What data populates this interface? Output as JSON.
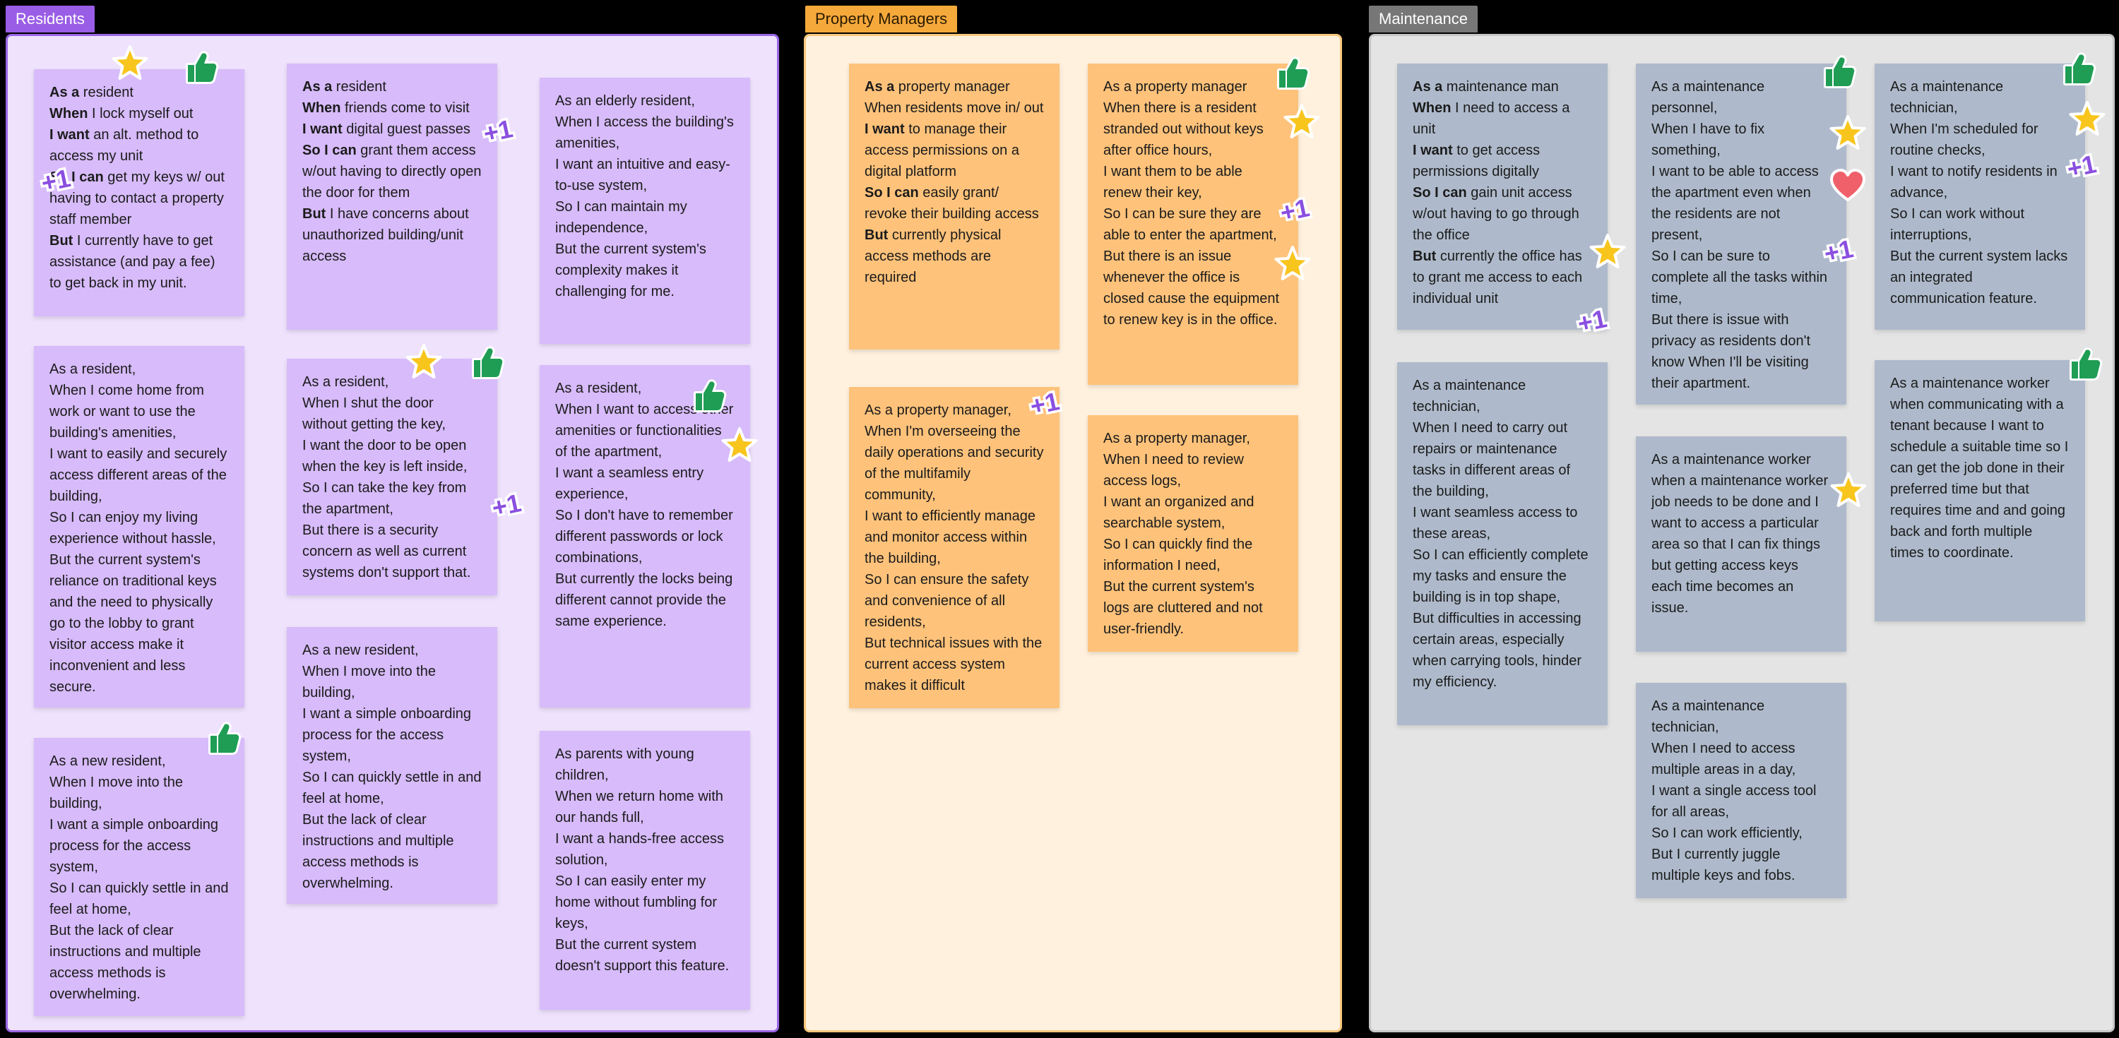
{
  "sections": {
    "residents": "Residents",
    "property_managers": "Property Managers",
    "maintenance": "Maintenance"
  },
  "colors": {
    "residents_note": "#d7bbfa",
    "pm_note": "#fec27a",
    "maintenance_note": "#aebacb",
    "thumb": "#1f9d55",
    "star": "#f8c51c",
    "plus_one": "#8a4fe0",
    "heart": "#f0606a"
  },
  "stickers": {
    "thumb": "thumbs-up",
    "star": "star",
    "plus_one": "+1",
    "heart": "heart"
  },
  "notes": {
    "r1": [
      {
        "k": "As a",
        "t": " resident"
      },
      {
        "k": "When",
        "t": " I lock myself out"
      },
      {
        "k": "I want",
        "t": " an alt. method to access my unit"
      },
      {
        "k": "So I can",
        "t": " get my keys w/ out having to contact a property staff member"
      },
      {
        "k": "But",
        "t": " I currently have to get assistance (and pay a fee) to get back in my unit."
      }
    ],
    "r2": [
      {
        "k": "As a",
        "t": " resident"
      },
      {
        "k": "When",
        "t": " friends come to visit"
      },
      {
        "k": "I want",
        "t": " digital guest passes"
      },
      {
        "k": "So I can",
        "t": " grant them access w/out having to directly open the door for them"
      },
      {
        "k": "But",
        "t": " I have concerns about unauthorized building/unit access"
      }
    ],
    "r3": [
      {
        "k": "",
        "t": "As an elderly resident,"
      },
      {
        "k": "",
        "t": "When I access the building's amenities,"
      },
      {
        "k": "",
        "t": "I want an intuitive and easy-to-use system,"
      },
      {
        "k": "",
        "t": "So I can maintain my independence,"
      },
      {
        "k": "",
        "t": "But the current system's complexity makes it challenging for me."
      }
    ],
    "r4": [
      {
        "k": "",
        "t": "As a resident,"
      },
      {
        "k": "",
        "t": "When I come home from work or want to use the building's amenities,"
      },
      {
        "k": "",
        "t": "I want to easily and securely access different areas of the building,"
      },
      {
        "k": "",
        "t": "So I can enjoy my living experience without hassle,"
      },
      {
        "k": "",
        "t": "But the current system's reliance on traditional keys and the need to physically go to the lobby to grant visitor access make it inconvenient and less secure."
      }
    ],
    "r5": [
      {
        "k": "",
        "t": "As a resident,"
      },
      {
        "k": "",
        "t": "When I shut the door without getting the key,"
      },
      {
        "k": "",
        "t": "I want the door to be open when the key is left inside,"
      },
      {
        "k": "",
        "t": "So I can take the key from the apartment,"
      },
      {
        "k": "",
        "t": "But there is a security concern as well as current systems don't support that."
      }
    ],
    "r6": [
      {
        "k": "",
        "t": "As a resident,"
      },
      {
        "k": "",
        "t": "When I want to access other amenities or functionalities of the apartment,"
      },
      {
        "k": "",
        "t": "I want a seamless entry experience,"
      },
      {
        "k": "",
        "t": "So I don't have to remember different passwords or lock combinations,"
      },
      {
        "k": "",
        "t": "But currently the locks being different cannot provide the same experience."
      }
    ],
    "r7": [
      {
        "k": "",
        "t": "As a new resident,"
      },
      {
        "k": "",
        "t": "When I move into the building,"
      },
      {
        "k": "",
        "t": "I want a simple onboarding process for the access system,"
      },
      {
        "k": "",
        "t": "So I can quickly settle in and feel at home,"
      },
      {
        "k": "",
        "t": "But the lack of clear instructions and multiple access methods is overwhelming."
      }
    ],
    "r8": [
      {
        "k": "",
        "t": "As a new resident,"
      },
      {
        "k": "",
        "t": "When I move into the building,"
      },
      {
        "k": "",
        "t": "I want a simple onboarding process for the access system,"
      },
      {
        "k": "",
        "t": "So I can quickly settle in and feel at home,"
      },
      {
        "k": "",
        "t": "But the lack of clear instructions and multiple access methods is overwhelming."
      }
    ],
    "r9": [
      {
        "k": "",
        "t": "As parents with young children,"
      },
      {
        "k": "",
        "t": "When we return home with our hands full,"
      },
      {
        "k": "",
        "t": "I want a hands-free access solution,"
      },
      {
        "k": "",
        "t": "So I can easily enter my home without fumbling for keys,"
      },
      {
        "k": "",
        "t": "But the current system doesn't support this feature."
      }
    ],
    "p1": [
      {
        "k": "As a",
        "t": " property manager"
      },
      {
        "k": "",
        "t": "When residents move in/ out"
      },
      {
        "k": "I want",
        "t": " to manage their access permissions on a digital platform"
      },
      {
        "k": "So I can",
        "t": " easily grant/ revoke their building access"
      },
      {
        "k": "But",
        "t": " currently physical access methods are required"
      }
    ],
    "p2": [
      {
        "k": "",
        "t": "As a property manager"
      },
      {
        "k": "",
        "t": "When there is a resident stranded out without keys after office hours,"
      },
      {
        "k": "",
        "t": "I want them to be able renew their key,"
      },
      {
        "k": "",
        "t": "So I can be sure they are able to enter the apartment,"
      },
      {
        "k": "",
        "t": "But there is an issue whenever the office is closed cause the equipment to renew key is in the office."
      }
    ],
    "p3": [
      {
        "k": "",
        "t": "As a property manager,"
      },
      {
        "k": "",
        "t": "When I'm overseeing the daily operations and security of the multifamily community,"
      },
      {
        "k": "",
        "t": "I want to efficiently manage and monitor access within the building,"
      },
      {
        "k": "",
        "t": "So I can ensure the safety and convenience of all residents,"
      },
      {
        "k": "",
        "t": "But technical issues with the current access system makes it difficult"
      }
    ],
    "p4": [
      {
        "k": "",
        "t": "As a property manager,"
      },
      {
        "k": "",
        "t": "When I need to review access logs,"
      },
      {
        "k": "",
        "t": "I want an organized and searchable system,"
      },
      {
        "k": "",
        "t": "So I can quickly find the information I need,"
      },
      {
        "k": "",
        "t": "But the current system's logs are cluttered and not user-friendly."
      }
    ],
    "m1": [
      {
        "k": "As a",
        "t": " maintenance man"
      },
      {
        "k": "When",
        "t": " I need to access a unit"
      },
      {
        "k": "I want",
        "t": " to get access permissions digitally"
      },
      {
        "k": "So I can",
        "t": " gain unit access w/out having to go through the office"
      },
      {
        "k": "But",
        "t": " currently the office has to grant me access to each individual unit"
      }
    ],
    "m2": [
      {
        "k": "",
        "t": "As a maintenance personnel,"
      },
      {
        "k": "",
        "t": "When I have to fix something,"
      },
      {
        "k": "",
        "t": "I want to be able to access the apartment even when the residents are not present,"
      },
      {
        "k": "",
        "t": "So I can be sure to complete all the tasks within time,"
      },
      {
        "k": "",
        "t": "But there is issue with privacy as residents don't know When I'll be visiting their apartment."
      }
    ],
    "m3": [
      {
        "k": "",
        "t": "As a maintenance technician,"
      },
      {
        "k": "",
        "t": "When I'm scheduled for routine checks,"
      },
      {
        "k": "",
        "t": "I want to notify residents in advance,"
      },
      {
        "k": "",
        "t": "So I can work without interruptions,"
      },
      {
        "k": "",
        "t": "But the current system lacks an integrated communication feature."
      }
    ],
    "m4": [
      {
        "k": "",
        "t": "As a maintenance technician,"
      },
      {
        "k": "",
        "t": "When I need to carry out repairs or maintenance tasks in different areas of the building,"
      },
      {
        "k": "",
        "t": "I want seamless access to these areas,"
      },
      {
        "k": "",
        "t": "So I can efficiently complete my tasks and ensure the building is in top shape,"
      },
      {
        "k": "",
        "t": "But difficulties in accessing certain areas, especially when carrying tools, hinder my efficiency."
      }
    ],
    "m5": [
      {
        "k": "",
        "t": "As a maintenance worker when a maintenance worker job needs to be done and I want to access a particular area so that I can fix things but getting access keys each time becomes an issue."
      }
    ],
    "m6": [
      {
        "k": "",
        "t": "As a maintenance worker when communicating with a tenant because I want to schedule a suitable time so I can get the job done in their preferred time but that requires time and and going back and forth multiple times to coordinate."
      }
    ],
    "m7": [
      {
        "k": "",
        "t": "As a maintenance technician,"
      },
      {
        "k": "",
        "t": "When I need to access multiple areas in a day,"
      },
      {
        "k": "",
        "t": "I want a single access tool for all areas,"
      },
      {
        "k": "",
        "t": "So I can work efficiently,"
      },
      {
        "k": "",
        "t": "But I currently juggle multiple keys and fobs."
      }
    ]
  }
}
